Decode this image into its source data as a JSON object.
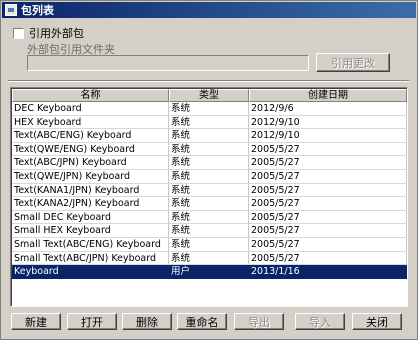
{
  "window": {
    "title": "包列表"
  },
  "options": {
    "use_external_label": "引用外部包",
    "external_file_label": "外部包引用文件夹",
    "external_path_value": "",
    "change_ref_button": "引用更改"
  },
  "table": {
    "columns": [
      "名称",
      "类型",
      "创建日期"
    ],
    "rows": [
      {
        "name": "DEC Keyboard",
        "type": "系统",
        "date": "2012/9/6"
      },
      {
        "name": "HEX Keyboard",
        "type": "系统",
        "date": "2012/9/10"
      },
      {
        "name": "Text(ABC/ENG) Keyboard",
        "type": "系统",
        "date": "2012/9/10"
      },
      {
        "name": "Text(QWE/ENG) Keyboard",
        "type": "系统",
        "date": "2005/5/27"
      },
      {
        "name": "Text(ABC/JPN) Keyboard",
        "type": "系统",
        "date": "2005/5/27"
      },
      {
        "name": "Text(QWE/JPN) Keyboard",
        "type": "系统",
        "date": "2005/5/27"
      },
      {
        "name": "Text(KANA1/JPN) Keyboard",
        "type": "系统",
        "date": "2005/5/27"
      },
      {
        "name": "Text(KANA2/JPN) Keyboard",
        "type": "系统",
        "date": "2005/5/27"
      },
      {
        "name": "Small DEC Keyboard",
        "type": "系统",
        "date": "2005/5/27"
      },
      {
        "name": "Small HEX Keyboard",
        "type": "系统",
        "date": "2005/5/27"
      },
      {
        "name": "Small Text(ABC/ENG) Keyboard",
        "type": "系统",
        "date": "2005/5/27"
      },
      {
        "name": "Small Text(ABC/JPN) Keyboard",
        "type": "系统",
        "date": "2005/5/27"
      },
      {
        "name": "Keyboard",
        "type": "用户",
        "date": "2013/1/16"
      }
    ]
  },
  "buttons": {
    "new": "新建",
    "open": "打开",
    "delete": "删除",
    "rename": "重命名",
    "export": "导出",
    "import": "导入",
    "close": "关闭"
  },
  "colors": {
    "selection": "#0a246a",
    "title_bar": "#0a246a"
  }
}
